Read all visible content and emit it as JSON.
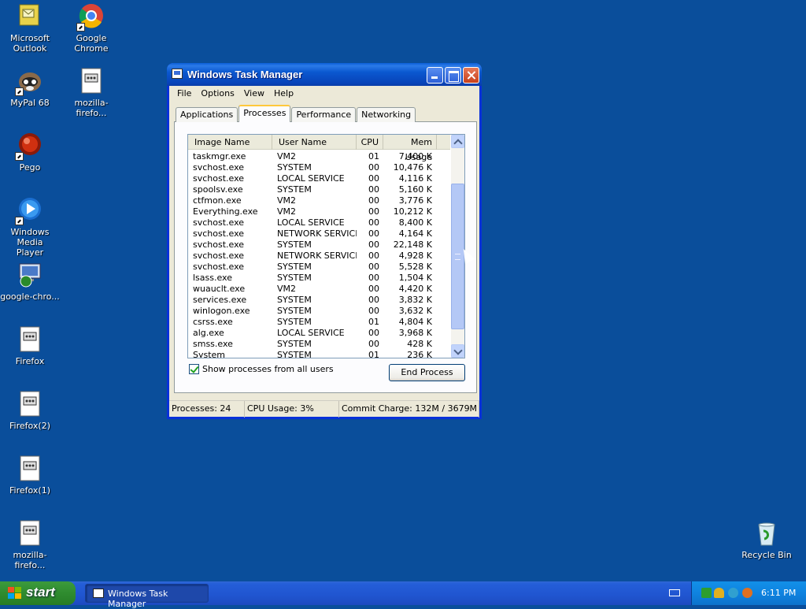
{
  "desktop": {
    "icons": [
      {
        "label": "Microsoft\nOutlook",
        "icon": "outlook-icon"
      },
      {
        "label": "Google Chrome",
        "icon": "chrome-icon"
      },
      {
        "label": "MyPal 68",
        "icon": "mypal-icon"
      },
      {
        "label": "mozilla-firefo...",
        "icon": "html-file-icon"
      },
      {
        "label": "Pego",
        "icon": "pego-icon"
      },
      {
        "label": "Windows Media\nPlayer",
        "icon": "media-player-icon"
      },
      {
        "label": "google-chro...",
        "icon": "installer-icon"
      },
      {
        "label": "Firefox",
        "icon": "html-file-icon"
      },
      {
        "label": "Firefox(2)",
        "icon": "html-file-icon"
      },
      {
        "label": "Firefox(1)",
        "icon": "html-file-icon"
      },
      {
        "label": "mozilla-firefo...",
        "icon": "html-file-icon"
      },
      {
        "label": "Recycle Bin",
        "icon": "recycle-bin-icon"
      }
    ]
  },
  "window": {
    "title": "Windows Task Manager",
    "menu": [
      "File",
      "Options",
      "View",
      "Help"
    ],
    "tabs": [
      "Applications",
      "Processes",
      "Performance",
      "Networking"
    ],
    "active_tab": "Processes",
    "columns": [
      "Image Name",
      "User Name",
      "CPU",
      "Mem Usage"
    ],
    "processes": [
      {
        "name": "taskmgr.exe",
        "user": "VM2",
        "cpu": "01",
        "mem": "7,400 K"
      },
      {
        "name": "svchost.exe",
        "user": "SYSTEM",
        "cpu": "00",
        "mem": "10,476 K"
      },
      {
        "name": "svchost.exe",
        "user": "LOCAL SERVICE",
        "cpu": "00",
        "mem": "4,116 K"
      },
      {
        "name": "spoolsv.exe",
        "user": "SYSTEM",
        "cpu": "00",
        "mem": "5,160 K"
      },
      {
        "name": "ctfmon.exe",
        "user": "VM2",
        "cpu": "00",
        "mem": "3,776 K"
      },
      {
        "name": "Everything.exe",
        "user": "VM2",
        "cpu": "00",
        "mem": "10,212 K"
      },
      {
        "name": "svchost.exe",
        "user": "LOCAL SERVICE",
        "cpu": "00",
        "mem": "8,400 K"
      },
      {
        "name": "svchost.exe",
        "user": "NETWORK SERVICE",
        "cpu": "00",
        "mem": "4,164 K"
      },
      {
        "name": "svchost.exe",
        "user": "SYSTEM",
        "cpu": "00",
        "mem": "22,148 K"
      },
      {
        "name": "svchost.exe",
        "user": "NETWORK SERVICE",
        "cpu": "00",
        "mem": "4,928 K"
      },
      {
        "name": "svchost.exe",
        "user": "SYSTEM",
        "cpu": "00",
        "mem": "5,528 K"
      },
      {
        "name": "lsass.exe",
        "user": "SYSTEM",
        "cpu": "00",
        "mem": "1,504 K"
      },
      {
        "name": "wuauclt.exe",
        "user": "VM2",
        "cpu": "00",
        "mem": "4,420 K"
      },
      {
        "name": "services.exe",
        "user": "SYSTEM",
        "cpu": "00",
        "mem": "3,832 K"
      },
      {
        "name": "winlogon.exe",
        "user": "SYSTEM",
        "cpu": "00",
        "mem": "3,632 K"
      },
      {
        "name": "csrss.exe",
        "user": "SYSTEM",
        "cpu": "01",
        "mem": "4,804 K"
      },
      {
        "name": "alg.exe",
        "user": "LOCAL SERVICE",
        "cpu": "00",
        "mem": "3,968 K"
      },
      {
        "name": "smss.exe",
        "user": "SYSTEM",
        "cpu": "00",
        "mem": "428 K"
      },
      {
        "name": "System",
        "user": "SYSTEM",
        "cpu": "01",
        "mem": "236 K"
      }
    ],
    "show_all_label": "Show processes from all users",
    "show_all_checked": true,
    "end_process_label": "End Process",
    "status": {
      "processes": "Processes: 24",
      "cpu": "CPU Usage: 3%",
      "commit": "Commit Charge: 132M / 3679M"
    }
  },
  "taskbar": {
    "start_label": "start",
    "tasks": [
      "Windows Task Manager"
    ],
    "clock": "6:11 PM"
  }
}
